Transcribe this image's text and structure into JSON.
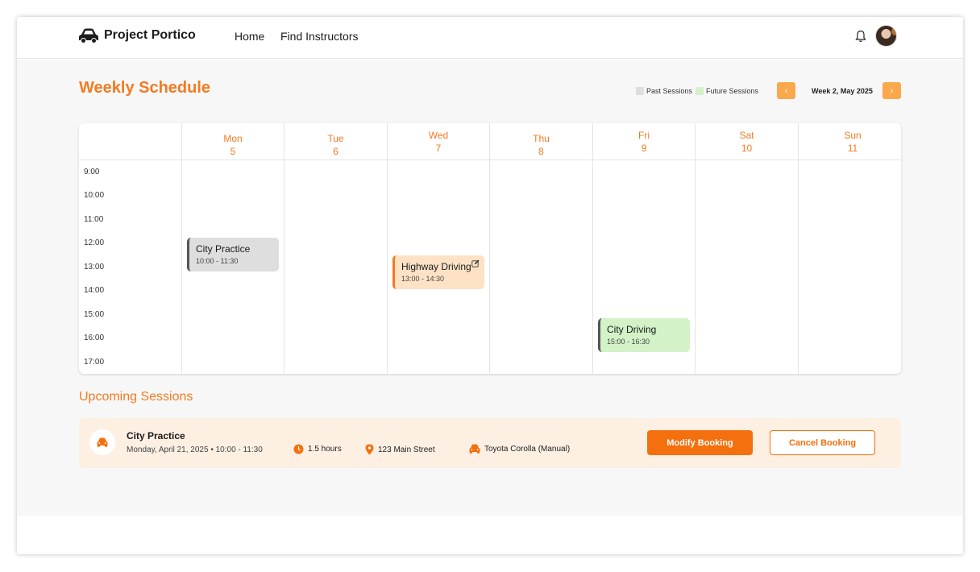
{
  "header": {
    "brand_name": "Project Portico",
    "nav": [
      "Home",
      "Find Instructors"
    ]
  },
  "schedule": {
    "title": "Weekly Schedule",
    "legend": {
      "past": "Past Sessions",
      "future": "Future Sessions"
    },
    "week_label": "Week 2, May 2025",
    "days": [
      {
        "name": "Mon",
        "date": "5"
      },
      {
        "name": "Tue",
        "date": "6"
      },
      {
        "name": "Wed",
        "date": "7"
      },
      {
        "name": "Thu",
        "date": "8"
      },
      {
        "name": "Fri",
        "date": "9"
      },
      {
        "name": "Sat",
        "date": "10"
      },
      {
        "name": "Sun",
        "date": "11"
      }
    ],
    "times": [
      "9:00",
      "10:00",
      "11:00",
      "12:00",
      "13:00",
      "14:00",
      "15:00",
      "16:00",
      "17:00"
    ],
    "events": [
      {
        "title": "City Practice",
        "time": "10:00 - 11:30",
        "status": "past"
      },
      {
        "title": "Highway Driving",
        "time": "13:00 - 14:30",
        "status": "current"
      },
      {
        "title": "City Driving",
        "time": "15:00 - 16:30",
        "status": "future"
      }
    ]
  },
  "upcoming": {
    "title": "Upcoming Sessions",
    "session": {
      "title": "City Practice",
      "subtitle": "Monday, April 21, 2025 • 10:00 - 11:30",
      "duration": "1.5 hours",
      "location": "123 Main Street",
      "vehicle": "Toyota Corolla (Manual)",
      "modify_label": "Modify Booking",
      "cancel_label": "Cancel Booking"
    }
  },
  "colors": {
    "accent": "#f47a20",
    "past_session": "#dedede",
    "future_session": "#d3f2c7",
    "current_session": "#fde2c5"
  },
  "icons": [
    "car-icon",
    "bell-icon",
    "chevron-left-icon",
    "chevron-right-icon",
    "edit-icon",
    "clock-icon",
    "location-pin-icon"
  ]
}
